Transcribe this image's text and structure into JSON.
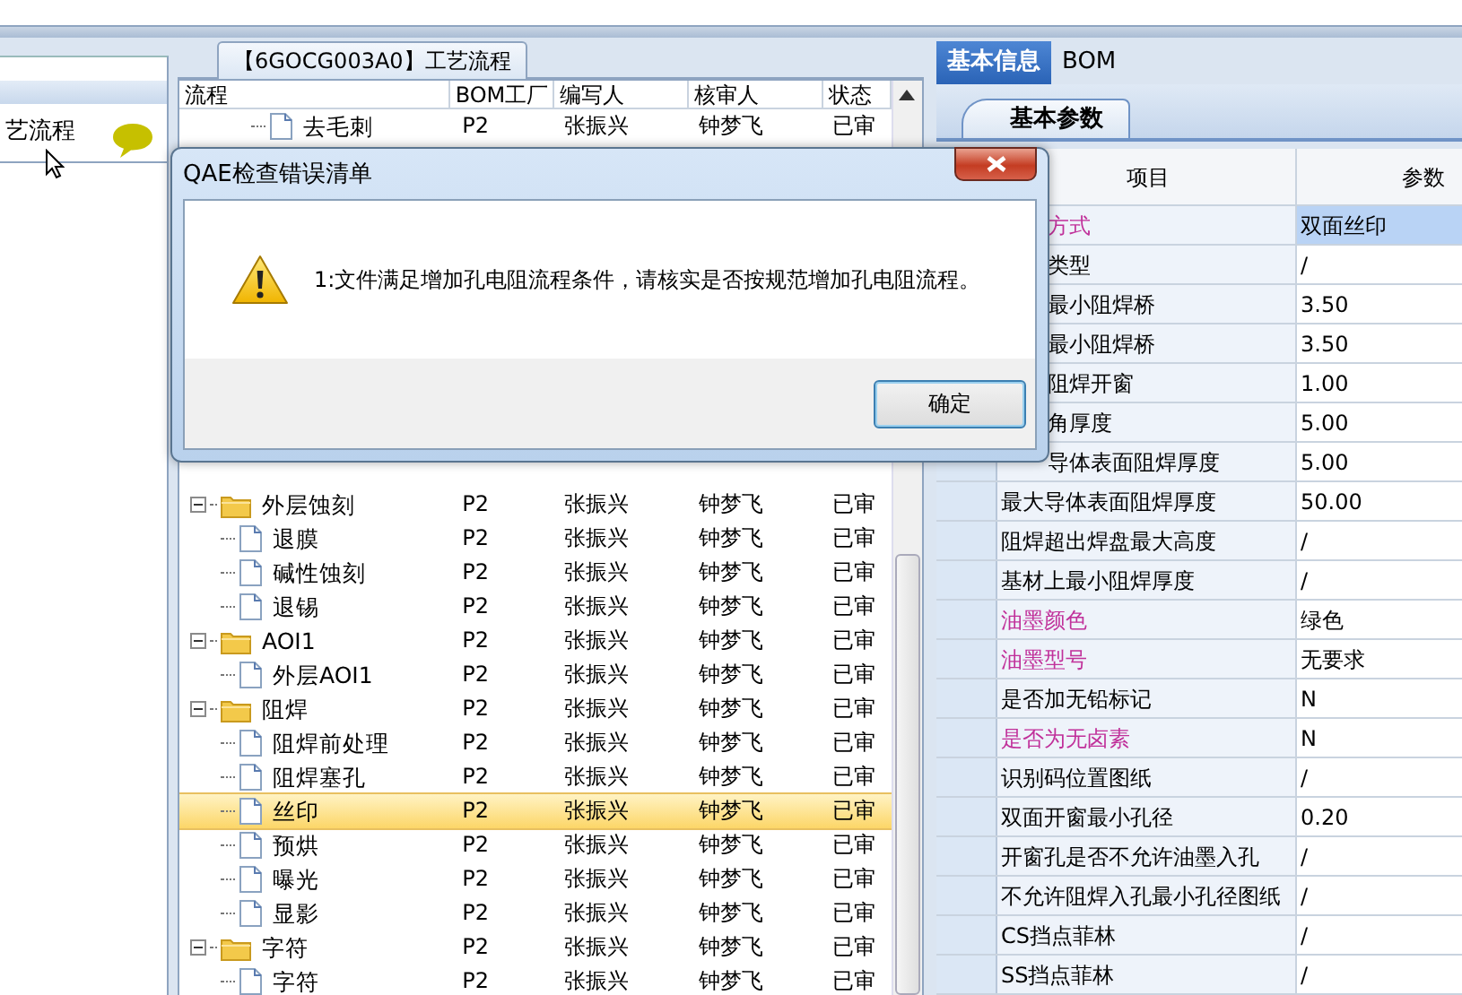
{
  "left_panel": {
    "items": [
      {
        "label": "艺流程",
        "selected": false
      }
    ]
  },
  "process_panel": {
    "tab": "【6GOCG003A0】工艺流程",
    "columns": [
      "流程",
      "BOM工厂",
      "编写人",
      "核审人",
      "状态"
    ],
    "top_rows": [
      {
        "kind": "file",
        "name": "去毛刺",
        "factory": "P2",
        "writer": "张振兴",
        "reviewer": "钟梦飞",
        "status": "已审",
        "selected": false
      }
    ],
    "rows": [
      {
        "kind": "folder",
        "expanded": true,
        "name": "外层蚀刻",
        "factory": "P2",
        "writer": "张振兴",
        "reviewer": "钟梦飞",
        "status": "已审",
        "selected": false,
        "children": [
          {
            "kind": "file",
            "name": "退膜",
            "factory": "P2",
            "writer": "张振兴",
            "reviewer": "钟梦飞",
            "status": "已审",
            "selected": false
          },
          {
            "kind": "file",
            "name": "碱性蚀刻",
            "factory": "P2",
            "writer": "张振兴",
            "reviewer": "钟梦飞",
            "status": "已审",
            "selected": false
          },
          {
            "kind": "file",
            "name": "退锡",
            "factory": "P2",
            "writer": "张振兴",
            "reviewer": "钟梦飞",
            "status": "已审",
            "selected": false
          }
        ]
      },
      {
        "kind": "folder",
        "expanded": true,
        "name": "AOI1",
        "factory": "P2",
        "writer": "张振兴",
        "reviewer": "钟梦飞",
        "status": "已审",
        "selected": false,
        "children": [
          {
            "kind": "file",
            "name": "外层AOI1",
            "factory": "P2",
            "writer": "张振兴",
            "reviewer": "钟梦飞",
            "status": "已审",
            "selected": false
          }
        ]
      },
      {
        "kind": "folder",
        "expanded": true,
        "name": "阻焊",
        "factory": "P2",
        "writer": "张振兴",
        "reviewer": "钟梦飞",
        "status": "已审",
        "selected": false,
        "children": [
          {
            "kind": "file",
            "name": "阻焊前处理",
            "factory": "P2",
            "writer": "张振兴",
            "reviewer": "钟梦飞",
            "status": "已审",
            "selected": false
          },
          {
            "kind": "file",
            "name": "阻焊塞孔",
            "factory": "P2",
            "writer": "张振兴",
            "reviewer": "钟梦飞",
            "status": "已审",
            "selected": false
          },
          {
            "kind": "file",
            "name": "丝印",
            "factory": "P2",
            "writer": "张振兴",
            "reviewer": "钟梦飞",
            "status": "已审",
            "selected": true
          },
          {
            "kind": "file",
            "name": "预烘",
            "factory": "P2",
            "writer": "张振兴",
            "reviewer": "钟梦飞",
            "status": "已审",
            "selected": false
          },
          {
            "kind": "file",
            "name": "曝光",
            "factory": "P2",
            "writer": "张振兴",
            "reviewer": "钟梦飞",
            "status": "已审",
            "selected": false
          },
          {
            "kind": "file",
            "name": "显影",
            "factory": "P2",
            "writer": "张振兴",
            "reviewer": "钟梦飞",
            "status": "已审",
            "selected": false
          }
        ]
      },
      {
        "kind": "folder",
        "expanded": true,
        "name": "字符",
        "factory": "P2",
        "writer": "张振兴",
        "reviewer": "钟梦飞",
        "status": "已审",
        "selected": false,
        "children": [
          {
            "kind": "file",
            "name": "字符",
            "factory": "P2",
            "writer": "张振兴",
            "reviewer": "钟梦飞",
            "status": "已审",
            "selected": false
          }
        ]
      }
    ]
  },
  "info_panel": {
    "tabs": [
      {
        "label": "基本信息",
        "selected": true
      },
      {
        "label": "BOM",
        "selected": false
      }
    ],
    "subtab": "基本参数",
    "columns": [
      "项目",
      "参数"
    ],
    "rows": [
      {
        "item": "方式",
        "value": "双面丝印",
        "required": true,
        "selected": true
      },
      {
        "item": "类型",
        "value": "/",
        "required": false,
        "selected": false
      },
      {
        "item": "最小阻焊桥",
        "value": "3.50",
        "required": false,
        "selected": false
      },
      {
        "item": "最小阻焊桥",
        "value": "3.50",
        "required": false,
        "selected": false
      },
      {
        "item": "阻焊开窗",
        "value": "1.00",
        "required": false,
        "selected": false
      },
      {
        "item": "角厚度",
        "value": "5.00",
        "required": false,
        "selected": false
      },
      {
        "item": "导体表面阻焊厚度",
        "value": "5.00",
        "required": false,
        "selected": false
      },
      {
        "item": "最大导体表面阻焊厚度",
        "value": "50.00",
        "required": false,
        "selected": false
      },
      {
        "item": "阻焊超出焊盘最大高度",
        "value": "/",
        "required": false,
        "selected": false
      },
      {
        "item": "基材上最小阻焊厚度",
        "value": "/",
        "required": false,
        "selected": false
      },
      {
        "item": "油墨颜色",
        "value": "绿色",
        "required": true,
        "selected": false
      },
      {
        "item": "油墨型号",
        "value": "无要求",
        "required": true,
        "selected": false
      },
      {
        "item": "是否加无铅标记",
        "value": "N",
        "required": false,
        "selected": false
      },
      {
        "item": "是否为无卤素",
        "value": "N",
        "required": true,
        "selected": false
      },
      {
        "item": "识别码位置图纸",
        "value": "/",
        "required": false,
        "selected": false
      },
      {
        "item": "双面开窗最小孔径",
        "value": "0.20",
        "required": false,
        "selected": false
      },
      {
        "item": "开窗孔是否不允许油墨入孔",
        "value": "/",
        "required": false,
        "selected": false
      },
      {
        "item": "不允许阻焊入孔最小孔径图纸",
        "value": "/",
        "required": false,
        "selected": false
      },
      {
        "item": "CS挡点菲林",
        "value": "/",
        "required": false,
        "selected": false
      },
      {
        "item": "SS挡点菲林",
        "value": "/",
        "required": false,
        "selected": false
      }
    ]
  },
  "dialog": {
    "title": "QAE检查错误清单",
    "message": "1:文件满足增加孔电阻流程条件，请核实是否按规范增加孔电阻流程。",
    "button": "确定"
  }
}
